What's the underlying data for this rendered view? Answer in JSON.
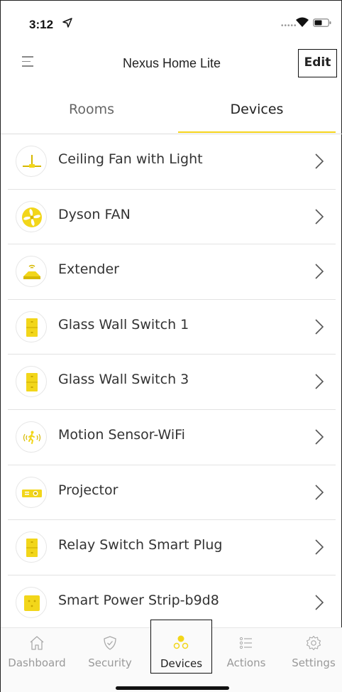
{
  "status_bar": {
    "time": "3:12",
    "signal_icon": "signal-dots-icon",
    "wifi_icon": "wifi-icon",
    "battery_icon": "battery-icon"
  },
  "nav": {
    "title": "Nexus Home Lite",
    "edit_label": "Edit",
    "menu_icon": "hamburger-menu-icon"
  },
  "tabs": {
    "rooms": "Rooms",
    "devices": "Devices",
    "active": "devices"
  },
  "devices": [
    {
      "name": "Ceiling Fan with Light",
      "icon": "ceiling-fan-icon"
    },
    {
      "name": "Dyson FAN",
      "icon": "fan-icon"
    },
    {
      "name": "Extender",
      "icon": "wifi-extender-icon"
    },
    {
      "name": "Glass Wall Switch 1",
      "icon": "wall-switch-icon"
    },
    {
      "name": "Glass Wall Switch 3",
      "icon": "wall-switch-icon"
    },
    {
      "name": "Motion Sensor-WiFi",
      "icon": "motion-sensor-icon"
    },
    {
      "name": "Projector",
      "icon": "projector-icon"
    },
    {
      "name": "Relay Switch Smart Plug",
      "icon": "wall-switch-icon"
    },
    {
      "name": "Smart Power Strip-b9d8",
      "icon": "power-strip-icon"
    }
  ],
  "tabbar": {
    "dashboard": "Dashboard",
    "security": "Security",
    "devices": "Devices",
    "actions": "Actions",
    "settings": "Settings",
    "active": "devices"
  },
  "colors": {
    "accent": "#f4d31c",
    "icon_yellow": "#f2d61a",
    "text": "#333333",
    "muted": "#999999"
  }
}
